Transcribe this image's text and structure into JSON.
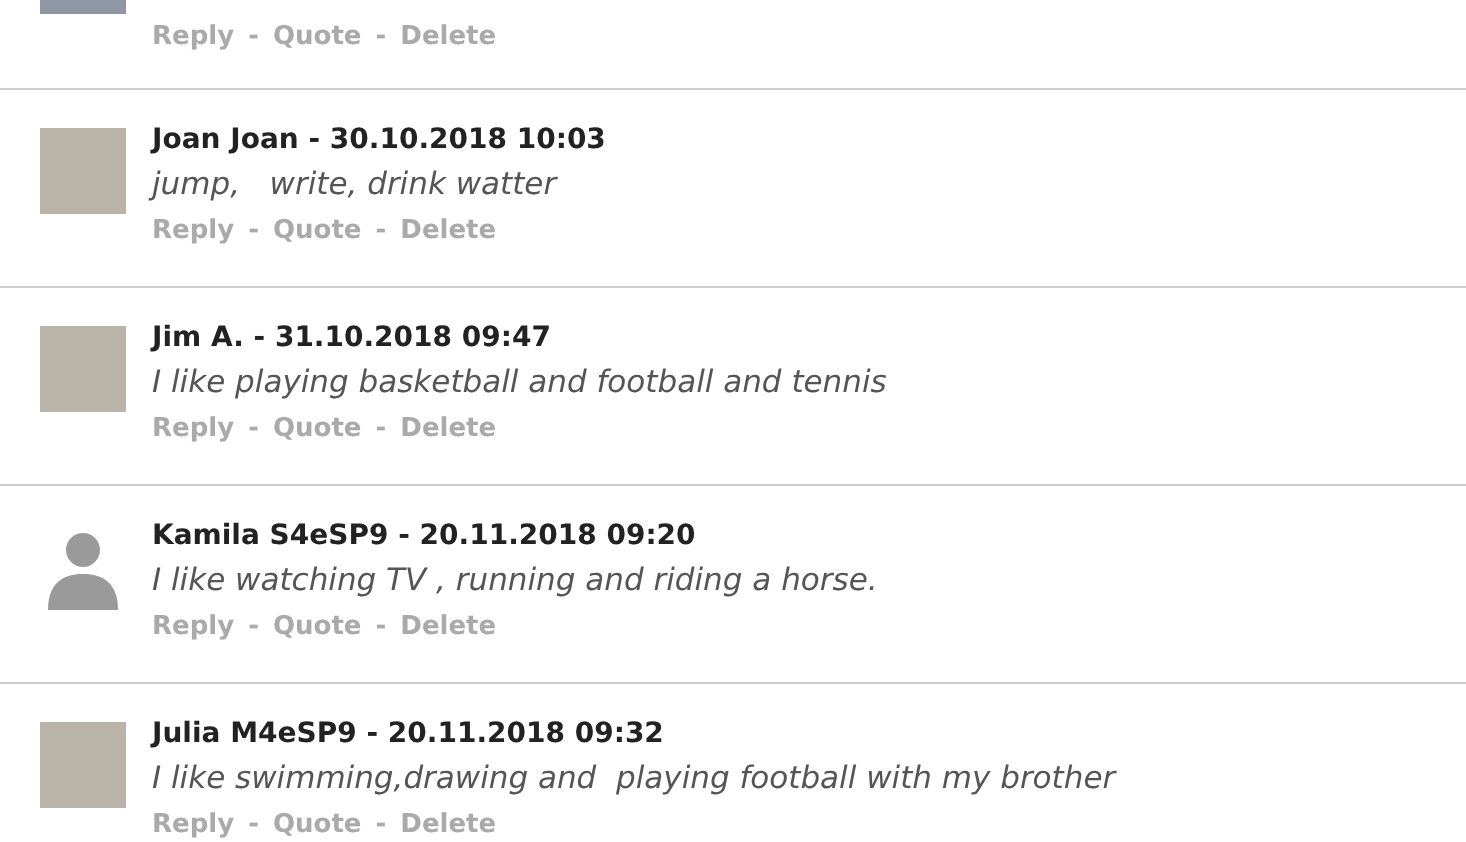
{
  "comments": [
    {
      "kind": "partial",
      "avatar": {
        "kind": "photo"
      },
      "actions": [
        "Reply",
        "Quote",
        "Delete"
      ],
      "separator": "-"
    },
    {
      "kind": "full",
      "avatar": {
        "kind": "photo"
      },
      "author": "Joan Joan",
      "date": "30.10.2018 10:03",
      "text": "jump,   write, drink watter",
      "actions": [
        "Reply",
        "Quote",
        "Delete"
      ],
      "separator": "-"
    },
    {
      "kind": "full",
      "avatar": {
        "kind": "photo"
      },
      "author": "Jim A.",
      "date": "31.10.2018 09:47",
      "text": "I like playing basketball and football and tennis",
      "actions": [
        "Reply",
        "Quote",
        "Delete"
      ],
      "separator": "-"
    },
    {
      "kind": "full",
      "avatar": {
        "kind": "silhouette"
      },
      "author": "Kamila S4eSP9",
      "date": "20.11.2018 09:20",
      "text": "I like watching TV , running and riding a horse.",
      "actions": [
        "Reply",
        "Quote",
        "Delete"
      ],
      "separator": "-"
    },
    {
      "kind": "full",
      "avatar": {
        "kind": "photo"
      },
      "author": "Julia M4eSP9",
      "date": "20.11.2018 09:32",
      "text": "I like swimming,drawing and  playing football with my brother",
      "actions": [
        "Reply",
        "Quote",
        "Delete"
      ],
      "separator": "-"
    }
  ]
}
